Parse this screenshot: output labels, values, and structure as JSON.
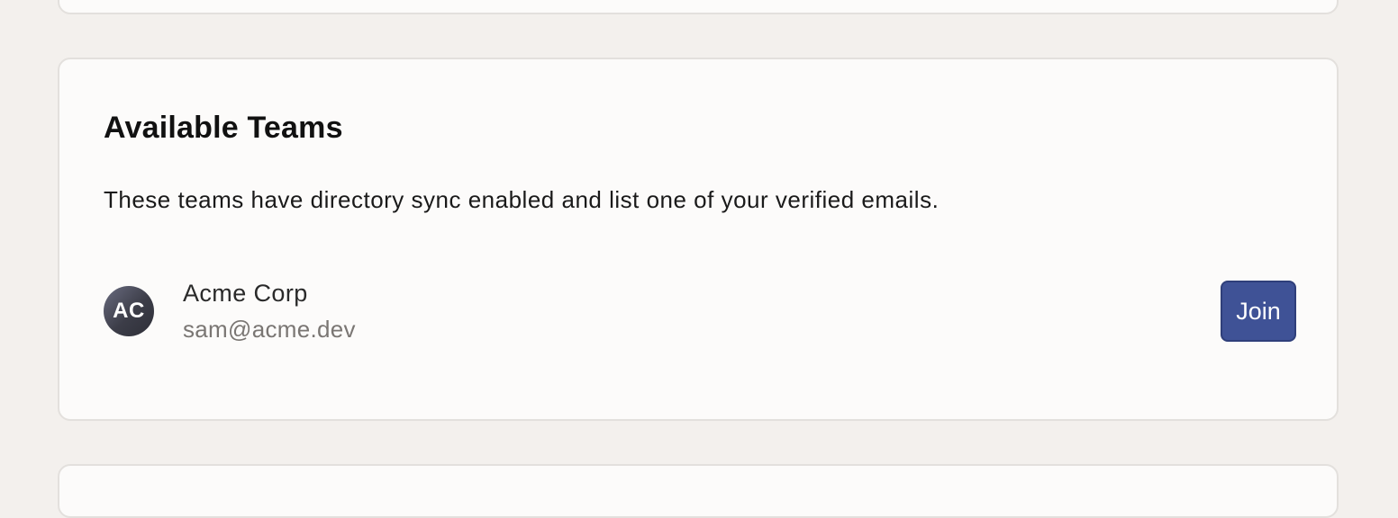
{
  "available_teams": {
    "title": "Available Teams",
    "description": "These teams have directory sync enabled and list one of your verified emails.",
    "teams": [
      {
        "initials": "AC",
        "name": "Acme Corp",
        "email": "sam@acme.dev",
        "action_label": "Join"
      }
    ]
  },
  "colors": {
    "page_background": "#f3f0ed",
    "card_background": "#fcfbfa",
    "card_border": "#e3e0dd",
    "primary_button": "#3f5296"
  }
}
